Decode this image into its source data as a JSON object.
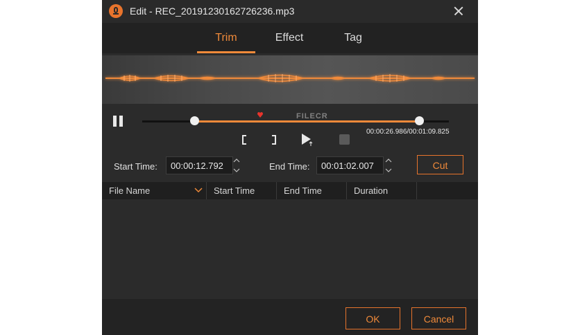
{
  "window": {
    "title": "Edit - REC_20191230162726236.mp3"
  },
  "tabs": [
    {
      "label": "Trim",
      "active": true
    },
    {
      "label": "Effect",
      "active": false
    },
    {
      "label": "Tag",
      "active": false
    }
  ],
  "player": {
    "time_readout": "00:00:26.986/00:01:09.825",
    "selection_start_fraction": 0.17,
    "selection_end_fraction": 0.91,
    "playhead_fraction": 0.38
  },
  "trim": {
    "start_label": "Start Time:",
    "start_value": "00:00:12.792",
    "end_label": "End Time:",
    "end_value": "00:01:02.007",
    "cut_label": "Cut"
  },
  "table": {
    "columns": [
      "File Name",
      "Start Time",
      "End Time",
      "Duration"
    ]
  },
  "footer": {
    "ok_label": "OK",
    "cancel_label": "Cancel"
  },
  "watermark": "FILECR",
  "colors": {
    "accent": "#f08a3a",
    "background": "#2b2b2b"
  }
}
